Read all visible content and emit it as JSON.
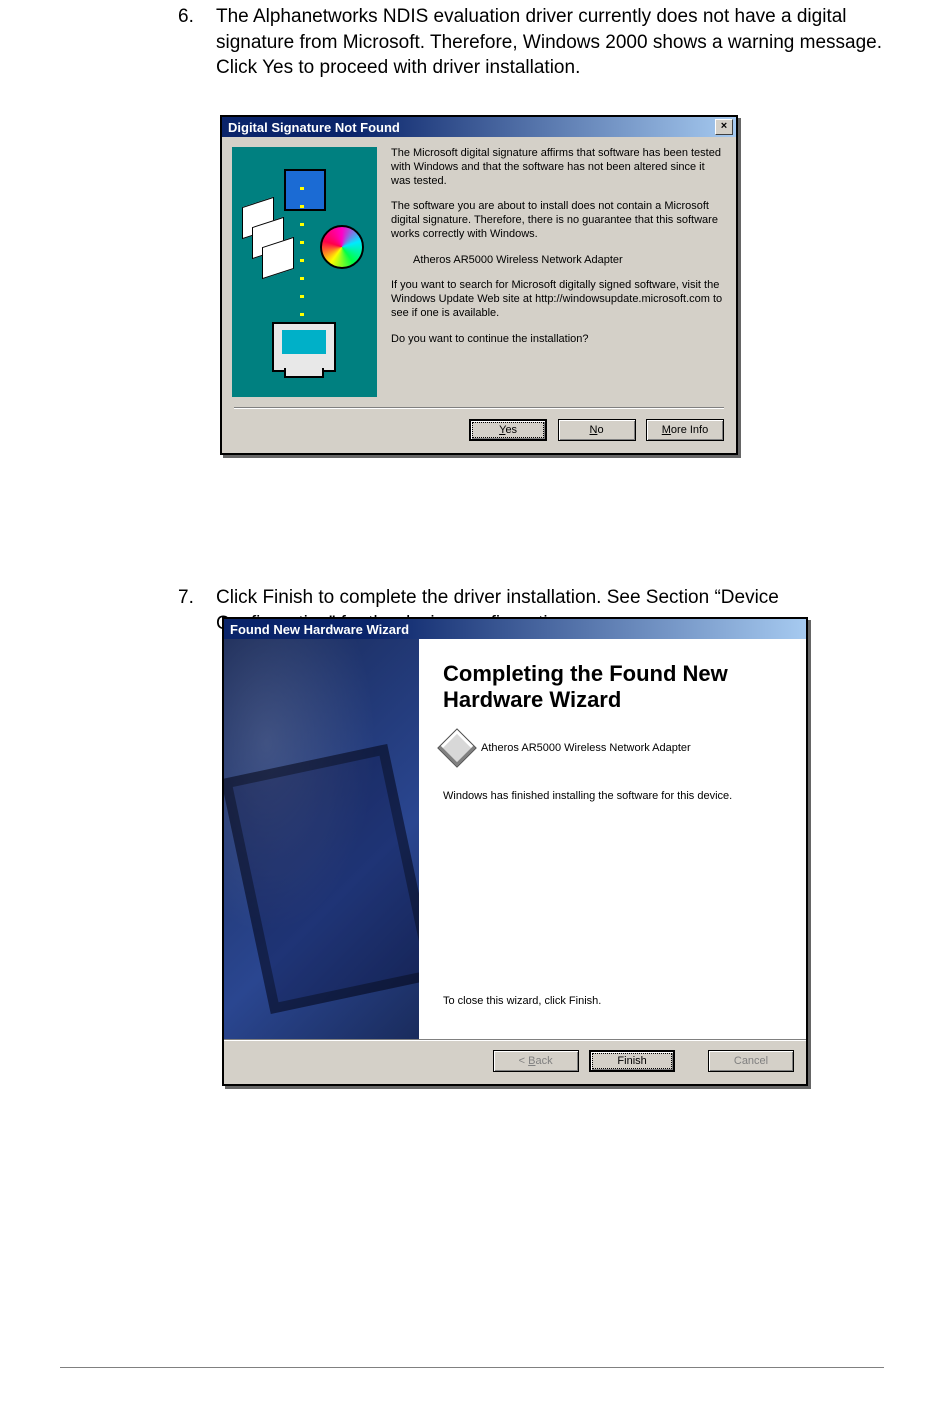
{
  "step6": {
    "num": "6.",
    "text": "The Alphanetworks NDIS evaluation driver currently does not have a digital signature from Microsoft. Therefore, Windows 2000 shows a warning message. Click Yes to proceed with driver installation."
  },
  "step7": {
    "num": "7.",
    "text": "Click Finish to complete the driver installation. See Section “Device Configuration” for the device configuration."
  },
  "dlg1": {
    "title": "Digital Signature Not Found",
    "close": "×",
    "p1": "The Microsoft digital signature affirms that software has been tested with Windows and that the software has not been altered since it was tested.",
    "p2": "The software you are about to install does not contain a Microsoft digital signature. Therefore,  there is no guarantee that this software works correctly with Windows.",
    "device": "Atheros AR5000 Wireless Network Adapter",
    "p3": "If you want to search for Microsoft digitally signed software, visit the Windows Update Web site at http://windowsupdate.microsoft.com to see if one is available.",
    "p4": "Do you want to continue the installation?",
    "yes_u": "Y",
    "yes_rest": "es",
    "no_u": "N",
    "no_rest": "o",
    "more_u": "M",
    "more_rest": "ore Info"
  },
  "dlg2": {
    "title": "Found New Hardware Wizard",
    "heading": "Completing the Found New Hardware Wizard",
    "device": "Atheros AR5000 Wireless Network Adapter",
    "done": "Windows has finished installing the software for this device.",
    "closehint": "To close this wizard, click Finish.",
    "back_lt": "< ",
    "back_u": "B",
    "back_rest": "ack",
    "finish": "Finish",
    "cancel": "Cancel"
  }
}
